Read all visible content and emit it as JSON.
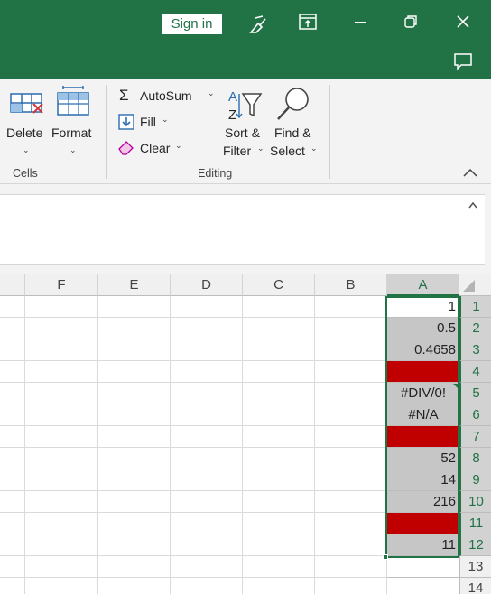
{
  "titlebar": {
    "signin_label": "Sign in",
    "icons": [
      "touch-mode-icon",
      "ribbon-display-options-icon",
      "minimize-icon",
      "restore-icon",
      "close-icon",
      "comments-icon"
    ]
  },
  "ribbon": {
    "cells_group": {
      "label": "Cells",
      "delete_label": "Delete",
      "format_label": "Format"
    },
    "editing_group": {
      "label": "Editing",
      "autosum_label": "AutoSum",
      "fill_label": "Fill",
      "clear_label": "Clear",
      "sort_filter_line1": "Sort &",
      "sort_filter_line2": "Filter",
      "find_select_line1": "Find &",
      "find_select_line2": "Select"
    }
  },
  "grid": {
    "columns": [
      "F",
      "E",
      "D",
      "C",
      "B",
      "A"
    ],
    "rows": [
      "1",
      "2",
      "3",
      "4",
      "5",
      "6",
      "7",
      "8",
      "9",
      "10",
      "11",
      "12",
      "13",
      "14"
    ],
    "column_a": [
      {
        "value": "1",
        "style": "active"
      },
      {
        "value": "0.5",
        "style": "gray"
      },
      {
        "value": "0.4658",
        "style": "gray"
      },
      {
        "value": "",
        "style": "red"
      },
      {
        "value": "#DIV/0!",
        "style": "gray-center"
      },
      {
        "value": "#N/A",
        "style": "gray-center"
      },
      {
        "value": "",
        "style": "red"
      },
      {
        "value": "52",
        "style": "gray"
      },
      {
        "value": "14",
        "style": "gray"
      },
      {
        "value": "216",
        "style": "gray"
      },
      {
        "value": "",
        "style": "red"
      },
      {
        "value": "11",
        "style": "gray"
      }
    ],
    "colors": {
      "accent": "#217346",
      "error_fill": "#c00000",
      "selection_fill": "#c6c6c6"
    }
  }
}
